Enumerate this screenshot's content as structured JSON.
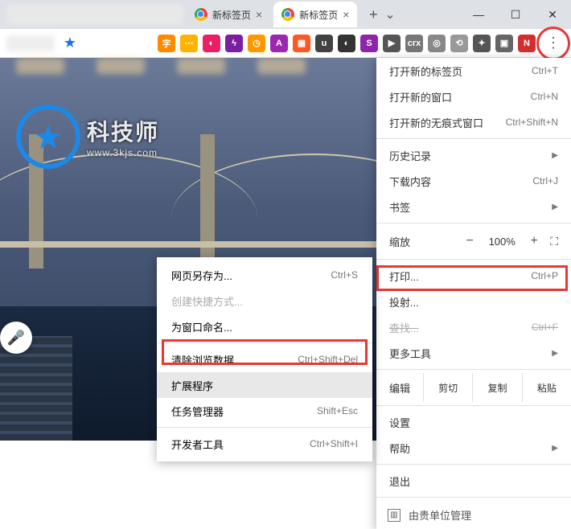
{
  "tabs": [
    {
      "title": "新标签页",
      "active": false
    },
    {
      "title": "新标签页",
      "active": true
    }
  ],
  "watermark": {
    "title": "科技师",
    "subtitle": "www.3kjs.com"
  },
  "menu": {
    "new_tab": {
      "label": "打开新的标签页",
      "shortcut": "Ctrl+T"
    },
    "new_window": {
      "label": "打开新的窗口",
      "shortcut": "Ctrl+N"
    },
    "incognito": {
      "label": "打开新的无痕式窗口",
      "shortcut": "Ctrl+Shift+N"
    },
    "history": {
      "label": "历史记录"
    },
    "downloads": {
      "label": "下载内容",
      "shortcut": "Ctrl+J"
    },
    "bookmarks": {
      "label": "书签"
    },
    "zoom": {
      "label": "缩放",
      "minus": "−",
      "value": "100%",
      "plus": "+"
    },
    "print": {
      "label": "打印...",
      "shortcut": "Ctrl+P"
    },
    "cast": {
      "label": "投射..."
    },
    "find": {
      "label": "查找...",
      "shortcut": "Ctrl+F"
    },
    "more_tools": {
      "label": "更多工具"
    },
    "edit": {
      "label": "编辑",
      "cut": "剪切",
      "copy": "复制",
      "paste": "粘贴"
    },
    "settings": {
      "label": "设置"
    },
    "help": {
      "label": "帮助"
    },
    "exit": {
      "label": "退出"
    },
    "managed": {
      "label": "由贵单位管理"
    }
  },
  "submenu": {
    "save_page": {
      "label": "网页另存为...",
      "shortcut": "Ctrl+S"
    },
    "create_shortcut": {
      "label": "创建快捷方式..."
    },
    "name_window": {
      "label": "为窗口命名..."
    },
    "clear_data": {
      "label": "清除浏览数据...",
      "shortcut": "Ctrl+Shift+Del"
    },
    "extensions": {
      "label": "扩展程序"
    },
    "task_manager": {
      "label": "任务管理器",
      "shortcut": "Shift+Esc"
    },
    "dev_tools": {
      "label": "开发者工具",
      "shortcut": "Ctrl+Shift+I"
    }
  },
  "ext_icons": [
    {
      "bg": "#ff8a00",
      "txt": "字"
    },
    {
      "bg": "#ffb300",
      "txt": "⋯"
    },
    {
      "bg": "#e91e63",
      "txt": "◐"
    },
    {
      "bg": "#7b1fa2",
      "txt": "ϟ"
    },
    {
      "bg": "#ff9800",
      "txt": "◷"
    },
    {
      "bg": "#9c27b0",
      "txt": "A"
    },
    {
      "bg": "#ff5722",
      "txt": "▦"
    },
    {
      "bg": "#424242",
      "txt": "u"
    },
    {
      "bg": "#333",
      "txt": "◐"
    },
    {
      "bg": "#8e24aa",
      "txt": "S"
    },
    {
      "bg": "#555",
      "txt": "▶"
    },
    {
      "bg": "#777",
      "txt": "crx"
    },
    {
      "bg": "#888",
      "txt": "◎"
    },
    {
      "bg": "#999",
      "txt": "⟲"
    },
    {
      "bg": "#555",
      "txt": "✦"
    },
    {
      "bg": "#666",
      "txt": "▣"
    },
    {
      "bg": "#d32f2f",
      "txt": "N"
    }
  ]
}
